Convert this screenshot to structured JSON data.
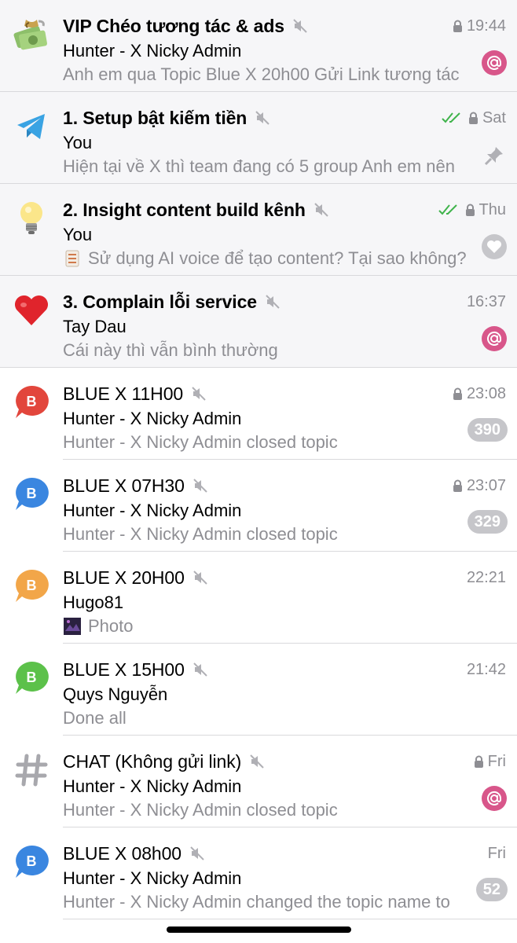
{
  "chats": [
    {
      "title": "VIP Chéo tương tác & ads",
      "avatar_icon": "money-bag-icon",
      "time": "19:44",
      "locked": true,
      "read_checks": false,
      "sender": "Hunter - X Nicky Admin",
      "preview": "Anh em qua Topic Blue X 20h00 Gửi Link tương tác",
      "badge": "mention",
      "pinned": true
    },
    {
      "title": "1. Setup bật kiếm tiền",
      "avatar_icon": "telegram-plane-icon",
      "time": "Sat",
      "locked": true,
      "read_checks": true,
      "sender": "You",
      "preview": "Hiện tại về X thì team đang có 5 group  Anh em nên",
      "badge": "pin",
      "pinned": true
    },
    {
      "title": "2. Insight content build kênh",
      "avatar_icon": "lightbulb-icon",
      "time": "Thu",
      "locked": true,
      "read_checks": true,
      "sender": "You",
      "preview": "Sử dụng AI voice để tạo content? Tại sao không?",
      "preview_icon": "list-emoji-icon",
      "badge": "heart",
      "pinned": true
    },
    {
      "title": "3. Complain lỗi service",
      "avatar_icon": "red-heart-icon",
      "time": "16:37",
      "locked": false,
      "read_checks": false,
      "sender": "Tay Dau",
      "preview": "Cái này thì vẫn bình thường",
      "badge": "mention",
      "pinned": true
    },
    {
      "title": "BLUE X 11H00",
      "avatar_icon": "topic-bubble-icon",
      "avatar_letter": "B",
      "avatar_color": "#e2463c",
      "time": "23:08",
      "locked": true,
      "read_checks": false,
      "sender": "Hunter - X Nicky Admin",
      "preview": "Hunter - X Nicky Admin closed topic",
      "badge": "count",
      "badge_value": "390",
      "pinned": false
    },
    {
      "title": "BLUE X 07H30",
      "avatar_icon": "topic-bubble-icon",
      "avatar_letter": "B",
      "avatar_color": "#3a86e0",
      "time": "23:07",
      "locked": true,
      "read_checks": false,
      "sender": "Hunter - X Nicky Admin",
      "preview": "Hunter - X Nicky Admin closed topic",
      "badge": "count",
      "badge_value": "329",
      "pinned": false
    },
    {
      "title": "BLUE X 20H00",
      "avatar_icon": "topic-bubble-icon",
      "avatar_letter": "B",
      "avatar_color": "#f2a649",
      "time": "22:21",
      "locked": false,
      "read_checks": false,
      "sender": "Hugo81",
      "preview": "Photo",
      "preview_icon": "photo-thumbnail-icon",
      "badge": "none",
      "pinned": false
    },
    {
      "title": "BLUE X 15H00",
      "avatar_icon": "topic-bubble-icon",
      "avatar_letter": "B",
      "avatar_color": "#5cc14a",
      "time": "21:42",
      "locked": false,
      "read_checks": false,
      "sender": "Quys Nguyễn",
      "preview": "Done all",
      "badge": "none",
      "pinned": false
    },
    {
      "title": "CHAT (Không gửi link)",
      "avatar_icon": "hash-icon",
      "time": "Fri",
      "locked": true,
      "read_checks": false,
      "sender": "Hunter - X Nicky Admin",
      "preview": "Hunter - X Nicky Admin closed topic",
      "badge": "mention",
      "pinned": false
    },
    {
      "title": "BLUE X 08h00",
      "avatar_icon": "topic-bubble-icon",
      "avatar_letter": "B",
      "avatar_color": "#3a86e0",
      "time": "Fri",
      "locked": false,
      "read_checks": false,
      "sender": "Hunter - X Nicky Admin",
      "preview": "Hunter - X Nicky Admin changed the topic name to",
      "badge": "count",
      "badge_value": "52",
      "pinned": false
    }
  ]
}
